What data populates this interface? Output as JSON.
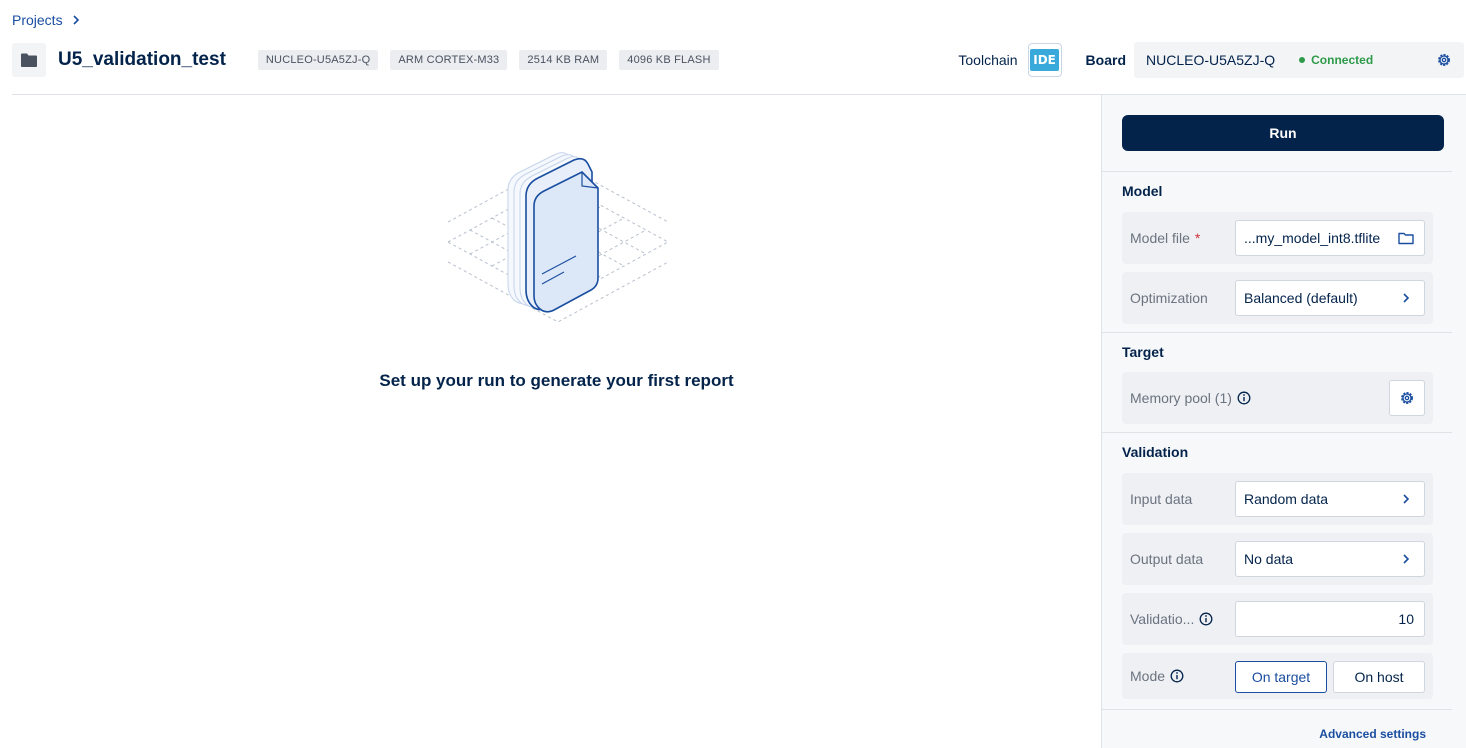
{
  "breadcrumb": {
    "projects": "Projects"
  },
  "project": {
    "title": "U5_validation_test",
    "chips": [
      "NUCLEO-U5A5ZJ-Q",
      "ARM CORTEX-M33",
      "2514 KB RAM",
      "4096 KB FLASH"
    ]
  },
  "toolchain": {
    "label": "Toolchain",
    "badge": "IDE"
  },
  "board": {
    "label": "Board",
    "name": "NUCLEO-U5A5ZJ-Q",
    "status": "Connected",
    "status_color": "#2e9a4a"
  },
  "main": {
    "empty_message": "Set up your run to generate your first report"
  },
  "panel": {
    "run_label": "Run",
    "model": {
      "title": "Model",
      "model_file_label": "Model file",
      "required_mark": "*",
      "model_file_value": "...my_model_int8.tflite",
      "optimization_label": "Optimization",
      "optimization_value": "Balanced (default)"
    },
    "target": {
      "title": "Target",
      "memory_pool_label": "Memory pool (1)"
    },
    "validation": {
      "title": "Validation",
      "input_data_label": "Input data",
      "input_data_value": "Random data",
      "output_data_label": "Output data",
      "output_data_value": "No data",
      "validation_count_label": "Validatio...",
      "validation_count_value": "10",
      "mode_label": "Mode",
      "mode_options": [
        "On target",
        "On host"
      ],
      "mode_selected": "On target"
    },
    "advanced_settings": "Advanced settings"
  },
  "colors": {
    "navy": "#03234b",
    "link_blue": "#1a4ea0",
    "connected_green": "#2e9a4a",
    "ide_blue": "#39a9dc"
  }
}
